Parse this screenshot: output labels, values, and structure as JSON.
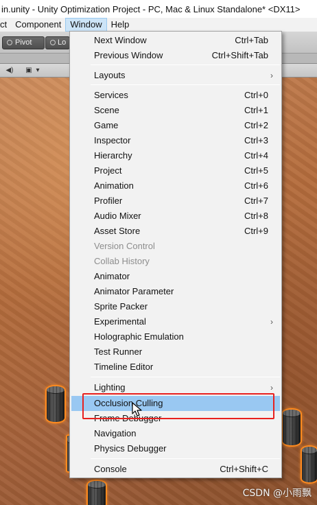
{
  "window": {
    "title": "in.unity - Unity Optimization Project - PC, Mac & Linux Standalone* <DX11>"
  },
  "menubar": {
    "items": [
      "ct",
      "Component",
      "Window",
      "Help"
    ]
  },
  "toolbar": {
    "pivot_label": "Pivot",
    "local_label": "Lo"
  },
  "window_menu": {
    "items": [
      {
        "label": "Next Window",
        "shortcut": "Ctrl+Tab"
      },
      {
        "label": "Previous Window",
        "shortcut": "Ctrl+Shift+Tab"
      },
      {
        "label": "Layouts",
        "submenu": true
      },
      {
        "label": "Services",
        "shortcut": "Ctrl+0"
      },
      {
        "label": "Scene",
        "shortcut": "Ctrl+1"
      },
      {
        "label": "Game",
        "shortcut": "Ctrl+2"
      },
      {
        "label": "Inspector",
        "shortcut": "Ctrl+3"
      },
      {
        "label": "Hierarchy",
        "shortcut": "Ctrl+4"
      },
      {
        "label": "Project",
        "shortcut": "Ctrl+5"
      },
      {
        "label": "Animation",
        "shortcut": "Ctrl+6"
      },
      {
        "label": "Profiler",
        "shortcut": "Ctrl+7"
      },
      {
        "label": "Audio Mixer",
        "shortcut": "Ctrl+8"
      },
      {
        "label": "Asset Store",
        "shortcut": "Ctrl+9"
      },
      {
        "label": "Version Control",
        "disabled": true
      },
      {
        "label": "Collab History",
        "disabled": true
      },
      {
        "label": "Animator"
      },
      {
        "label": "Animator Parameter"
      },
      {
        "label": "Sprite Packer"
      },
      {
        "label": "Experimental",
        "submenu": true
      },
      {
        "label": "Holographic Emulation"
      },
      {
        "label": "Test Runner"
      },
      {
        "label": "Timeline Editor"
      },
      {
        "label": "Lighting",
        "submenu": true
      },
      {
        "label": "Occlusion Culling",
        "highlighted": true
      },
      {
        "label": "Frame Debugger"
      },
      {
        "label": "Navigation"
      },
      {
        "label": "Physics Debugger"
      },
      {
        "label": "Console",
        "shortcut": "Ctrl+Shift+C"
      }
    ]
  },
  "watermark": "CSDN @小雨飘",
  "colors": {
    "highlight": "#99c8f2",
    "focus_outline": "#e8201e",
    "selection_outline": "#ff8a1e"
  }
}
